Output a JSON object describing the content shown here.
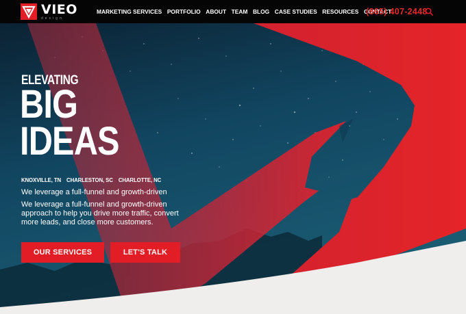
{
  "brand": {
    "name": "VIEO",
    "tagline": "design"
  },
  "nav": {
    "items": [
      {
        "label": "MARKETING SERVICES"
      },
      {
        "label": "PORTFOLIO"
      },
      {
        "label": "ABOUT"
      },
      {
        "label": "TEAM"
      },
      {
        "label": "BLOG"
      },
      {
        "label": "CASE STUDIES"
      },
      {
        "label": "RESOURCES"
      },
      {
        "label": "CONTACT"
      }
    ],
    "phone": "(865) 407-2448",
    "search_icon": "search-icon"
  },
  "hero": {
    "eyebrow": "ELEVATING",
    "headline_line1": "BIG",
    "headline_line2": "IDEAS",
    "cities": [
      "KNOXVILLE, TN",
      "CHARLESTON, SC",
      "CHARLOTTE, NC"
    ],
    "lead": "We leverage a full-funnel and growth-driven",
    "description": "We leverage a full-funnel and growth-driven approach to help you drive more traffic, convert more leads, and close more customers.",
    "buttons": {
      "services": "OUR SERVICES",
      "talk": "LET'S TALK"
    }
  },
  "colors": {
    "accent": "#e31d25",
    "header_bg": "#050505",
    "sky": "#0f3a52",
    "footer_curve": "#efeeed"
  }
}
